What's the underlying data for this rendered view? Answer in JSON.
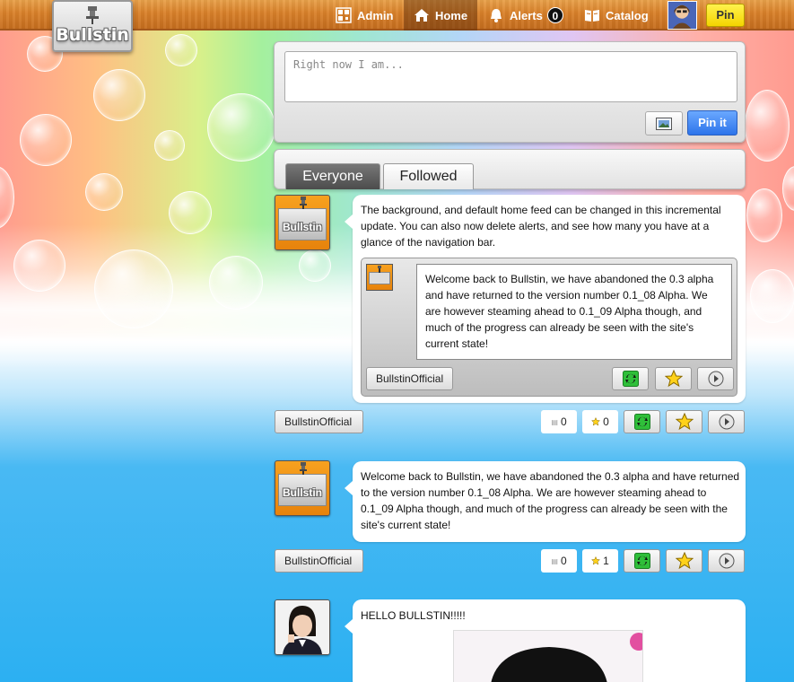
{
  "app": {
    "logo_text": "Bullstin"
  },
  "nav": {
    "admin": "Admin",
    "home": "Home",
    "alerts": "Alerts",
    "alerts_count": "0",
    "catalog": "Catalog",
    "pin": "Pin"
  },
  "composer": {
    "placeholder": "Right now I am...",
    "pin_it": "Pin it"
  },
  "tabs": {
    "everyone": "Everyone",
    "followed": "Followed"
  },
  "feed": {
    "post1": {
      "author": "BullstinOfficial",
      "avatar_text": "Bullstin",
      "text": "The background, and default home feed can be changed in this incremental update. You can also now delete alerts, and see how many you have at a glance of the navigation bar.",
      "shared": {
        "author": "BullstinOfficial",
        "text": "Welcome back to Bullstin, we have abandoned the 0.3 alpha and have returned to the version number 0.1_08 Alpha. We are however steaming ahead to 0.1_09 Alpha though, and much of the progress can already be seen with the site's current state!"
      },
      "comments": "0",
      "stars": "0"
    },
    "post2": {
      "author": "BullstinOfficial",
      "avatar_text": "Bullstin",
      "text": "Welcome back to Bullstin, we have abandoned the 0.3 alpha and have returned to the version number 0.1_08 Alpha. We are however steaming ahead to 0.1_09 Alpha though, and much of the progress can already be seen with the site's current state!",
      "comments": "0",
      "stars": "1"
    },
    "post3": {
      "text": "HELLO BULLSTIN!!!!!"
    }
  },
  "colors": {
    "topbar": "#d9812a",
    "pin_button": "#f4d400",
    "pin_it_button": "#2d74ea",
    "avatar_orange": "#f7a11f"
  }
}
